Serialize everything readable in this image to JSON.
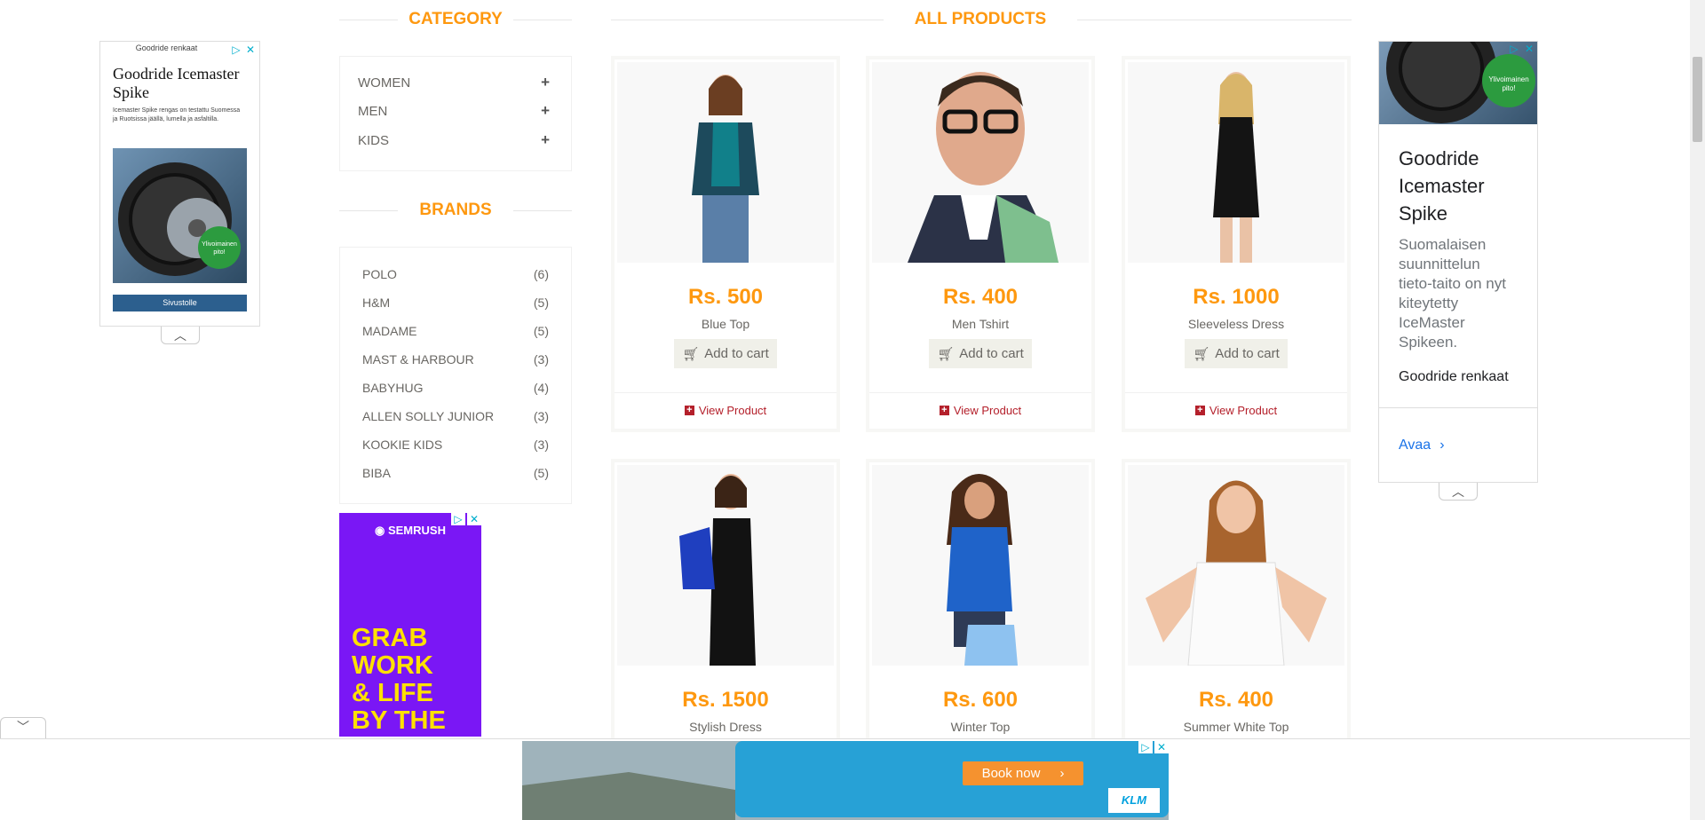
{
  "headings": {
    "category": "CATEGORY",
    "brands": "BRANDS",
    "all_products": "ALL PRODUCTS"
  },
  "categories": [
    {
      "label": "WOMEN",
      "icon": "plus-icon"
    },
    {
      "label": "MEN",
      "icon": "plus-icon"
    },
    {
      "label": "KIDS",
      "icon": "plus-icon"
    }
  ],
  "brands": [
    {
      "name": "POLO",
      "count": "(6)"
    },
    {
      "name": "H&M",
      "count": "(5)"
    },
    {
      "name": "MADAME",
      "count": "(5)"
    },
    {
      "name": "MAST & HARBOUR",
      "count": "(3)"
    },
    {
      "name": "BABYHUG",
      "count": "(4)"
    },
    {
      "name": "ALLEN SOLLY JUNIOR",
      "count": "(3)"
    },
    {
      "name": "KOOKIE KIDS",
      "count": "(3)"
    },
    {
      "name": "BIBA",
      "count": "(5)"
    }
  ],
  "products": [
    {
      "price": "Rs. 500",
      "name": "Blue Top",
      "cart_label": "Add to cart",
      "view_label": "View Product"
    },
    {
      "price": "Rs. 400",
      "name": "Men Tshirt",
      "cart_label": "Add to cart",
      "view_label": "View Product"
    },
    {
      "price": "Rs. 1000",
      "name": "Sleeveless Dress",
      "cart_label": "Add to cart",
      "view_label": "View Product"
    },
    {
      "price": "Rs. 1500",
      "name": "Stylish Dress"
    },
    {
      "price": "Rs. 600",
      "name": "Winter Top"
    },
    {
      "price": "Rs. 400",
      "name": "Summer White Top"
    }
  ],
  "ads": {
    "left": {
      "sponsor": "Goodride renkaat",
      "title": "Goodride Icemaster Spike",
      "body": "Icemaster Spike rengas on testattu Suomessa ja Ruotsissa jäällä, lumella ja asfaltilla.",
      "badge": "Ylivoimainen pito!",
      "cta": "Sivustolle"
    },
    "right": {
      "badge": "Ylivoimainen pito!",
      "title": "Goodride Icemaster Spike",
      "body": "Suomalaisen suunnittelun tieto-taito on nyt kiteytetty IceMaster Spikeen.",
      "sponsor": "Goodride renkaat",
      "cta": "Avaa"
    },
    "semrush": {
      "brand": "SEMRUSH",
      "lines": [
        "GRAB",
        "WORK",
        "& LIFE",
        "BY THE"
      ]
    },
    "bottom": {
      "cta": "Book now",
      "brand": "KLM"
    }
  },
  "colors": {
    "accent": "#FE980F",
    "view_link": "#b4202b",
    "semrush_bg": "#7a17f5",
    "semrush_text": "#ffe100",
    "ad_cta": "#2c5f8e",
    "bottom_cta": "#f5922f"
  }
}
